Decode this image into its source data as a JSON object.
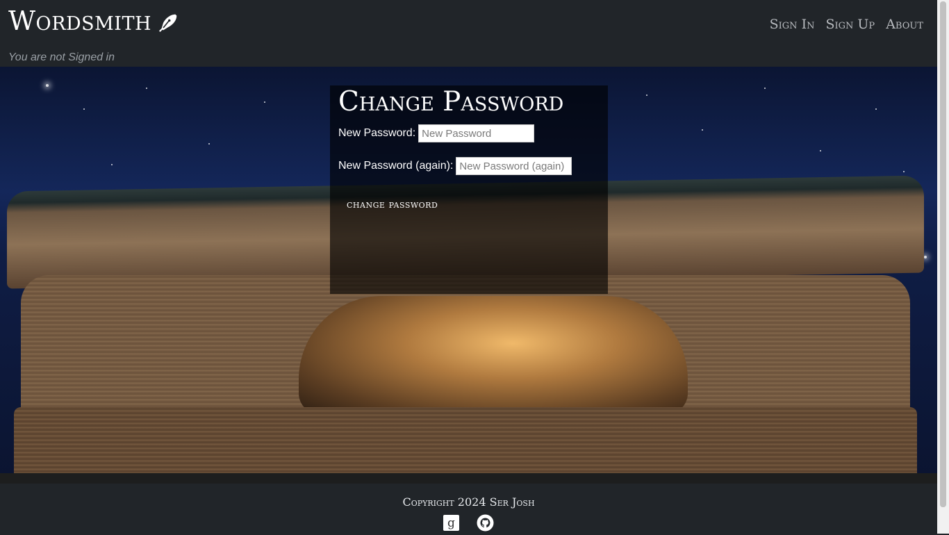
{
  "header": {
    "brand": "Wordsmith",
    "brand_icon": "fountain-pen-icon",
    "nav": [
      "Sign In",
      "Sign Up",
      "About"
    ],
    "status": "You are not Signed in"
  },
  "form": {
    "title": "Change Password",
    "fields": [
      {
        "label": "New Password:",
        "placeholder": "New Password",
        "value": ""
      },
      {
        "label": "New Password (again):",
        "placeholder": "New Password (again)",
        "value": ""
      }
    ],
    "submit_label": "change password"
  },
  "footer": {
    "copyright": "Copyright 2024 Ser Josh",
    "social": [
      "goodreads-icon",
      "github-icon"
    ]
  },
  "colors": {
    "navbar": "#212529",
    "panel": "rgba(0,0,0,0.62)",
    "text": "#ffffff"
  }
}
